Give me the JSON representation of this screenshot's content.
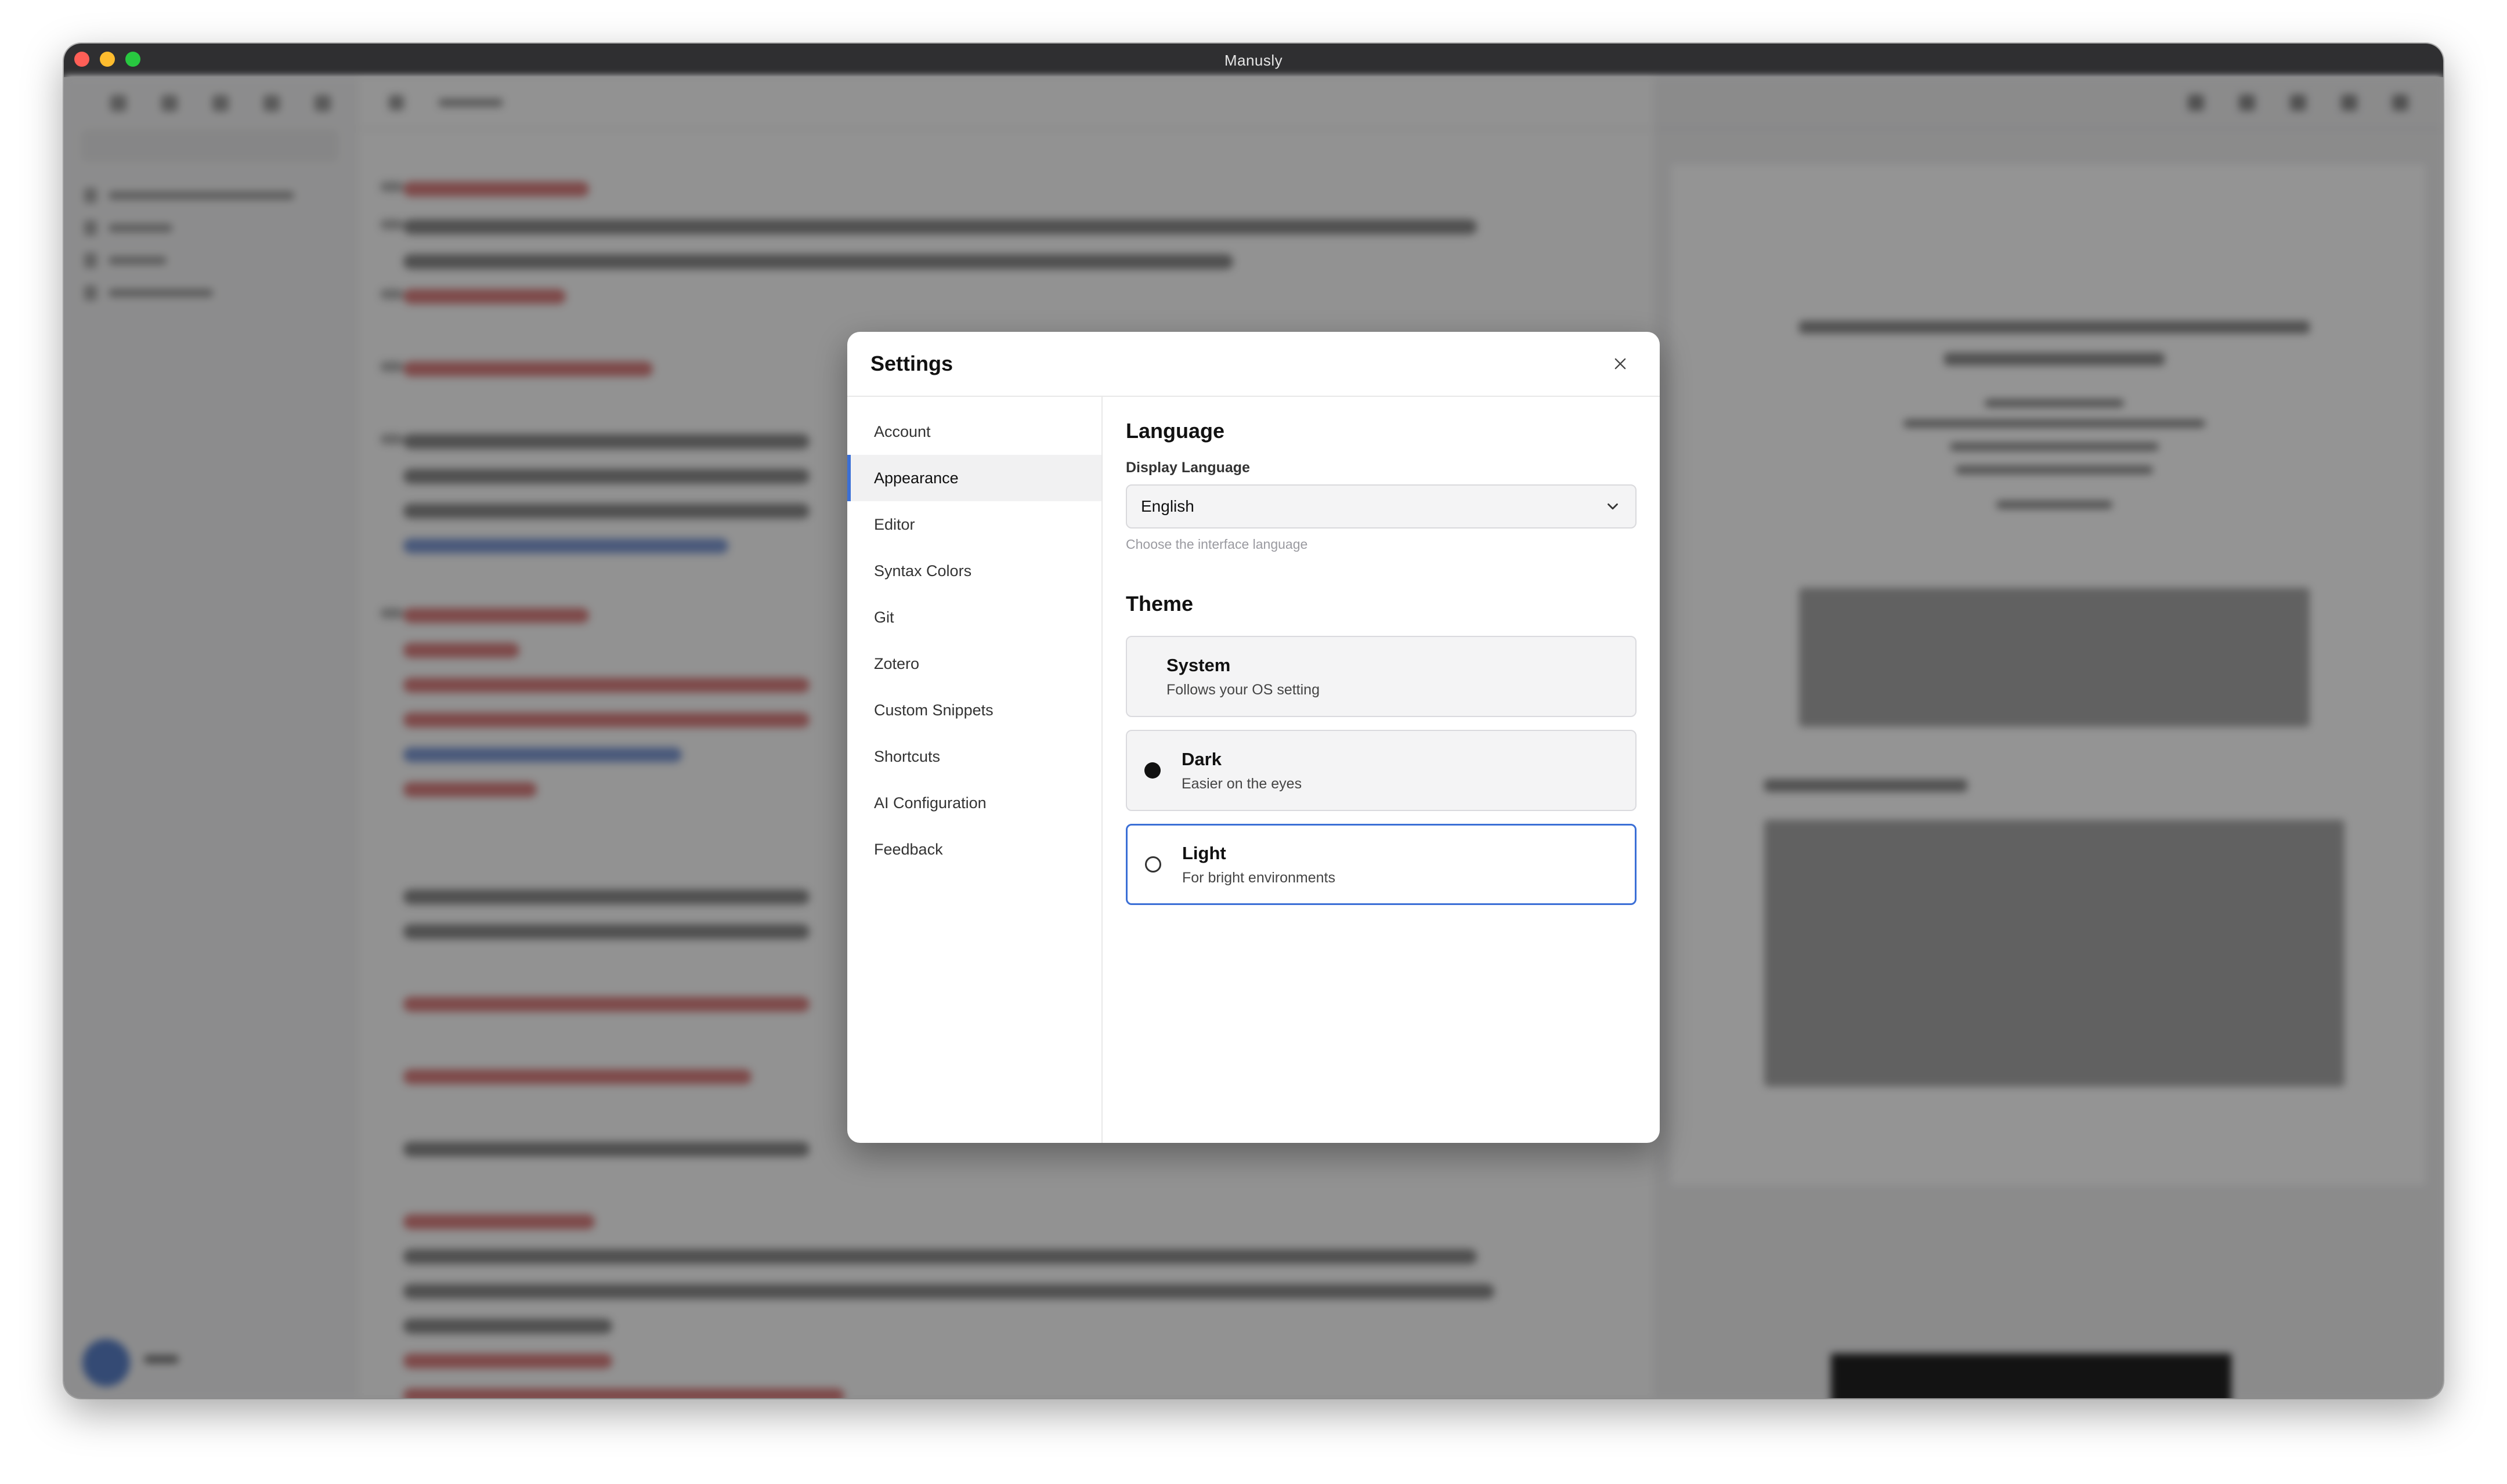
{
  "window": {
    "title": "Manusly"
  },
  "settings": {
    "title": "Settings",
    "nav": [
      {
        "label": "Account",
        "active": false
      },
      {
        "label": "Appearance",
        "active": true
      },
      {
        "label": "Editor",
        "active": false
      },
      {
        "label": "Syntax Colors",
        "active": false
      },
      {
        "label": "Git",
        "active": false
      },
      {
        "label": "Zotero",
        "active": false
      },
      {
        "label": "Custom Snippets",
        "active": false
      },
      {
        "label": "Shortcuts",
        "active": false
      },
      {
        "label": "AI Configuration",
        "active": false
      },
      {
        "label": "Feedback",
        "active": false
      }
    ],
    "language": {
      "section_title": "Language",
      "field_label": "Display Language",
      "selected": "English",
      "hint": "Choose the interface language"
    },
    "theme": {
      "section_title": "Theme",
      "options": [
        {
          "name": "System",
          "description": "Follows your OS setting"
        },
        {
          "name": "Dark",
          "description": "Easier on the eyes"
        },
        {
          "name": "Light",
          "description": "For bright environments"
        }
      ]
    }
  },
  "colors": {
    "accent": "#3b6fd6",
    "titlebar": "#2f2f31",
    "traffic_close": "#ff5f57",
    "traffic_minimize": "#febc2e",
    "traffic_maximize": "#28c840"
  },
  "icons": {
    "close": "close-icon",
    "dropdown": "chevron-down-icon"
  }
}
